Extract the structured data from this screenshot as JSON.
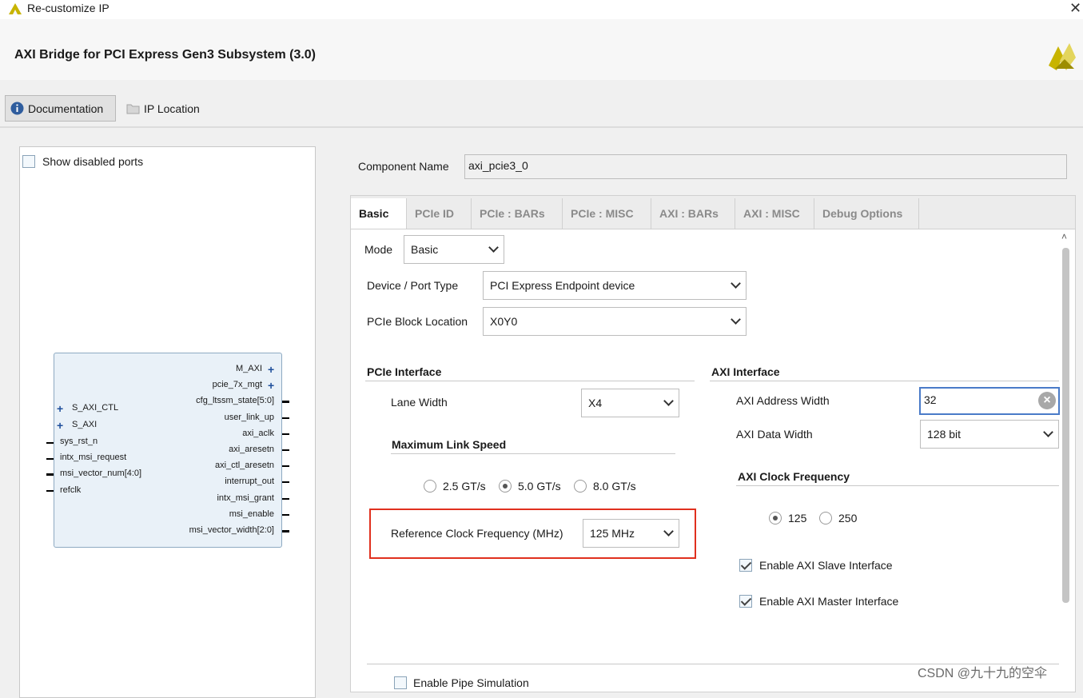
{
  "window": {
    "title": "Re-customize IP",
    "close_glyph": "✕"
  },
  "ip": {
    "title": "AXI Bridge for PCI Express Gen3 Subsystem (3.0)"
  },
  "toolbar": {
    "documentation": "Documentation",
    "ip_location": "IP Location"
  },
  "left": {
    "show_disabled_ports": "Show disabled ports",
    "block": {
      "left_ports": [
        "S_AXI_CTL",
        "S_AXI",
        "sys_rst_n",
        "intx_msi_request",
        "msi_vector_num[4:0]",
        "refclk"
      ],
      "right_ports": [
        "M_AXI",
        "pcie_7x_mgt",
        "cfg_ltssm_state[5:0]",
        "user_link_up",
        "axi_aclk",
        "axi_aresetn",
        "axi_ctl_aresetn",
        "interrupt_out",
        "intx_msi_grant",
        "msi_enable",
        "msi_vector_width[2:0]"
      ]
    }
  },
  "component": {
    "label": "Component Name",
    "value": "axi_pcie3_0"
  },
  "tabs": [
    "Basic",
    "PCIe ID",
    "PCIe : BARs",
    "PCIe : MISC",
    "AXI : BARs",
    "AXI : MISC",
    "Debug Options"
  ],
  "basic": {
    "mode_label": "Mode",
    "mode_value": "Basic",
    "device_label": "Device / Port Type",
    "device_value": "PCI Express Endpoint device",
    "location_label": "PCIe Block Location",
    "location_value": "X0Y0",
    "pcie_interface": {
      "title": "PCIe Interface",
      "lane_width_label": "Lane Width",
      "lane_width_value": "X4",
      "max_link_speed_title": "Maximum Link Speed",
      "speeds": [
        "2.5 GT/s",
        "5.0 GT/s",
        "8.0 GT/s"
      ],
      "selected_speed": "5.0 GT/s",
      "ref_clock_label": "Reference Clock Frequency (MHz)",
      "ref_clock_value": "125 MHz"
    },
    "axi_interface": {
      "title": "AXI Interface",
      "addr_width_label": "AXI Address Width",
      "addr_width_value": "32",
      "data_width_label": "AXI Data Width",
      "data_width_value": "128 bit",
      "clock_title": "AXI Clock Frequency",
      "clocks": [
        "125",
        "250"
      ],
      "selected_clock": "125",
      "enable_slave": "Enable AXI Slave Interface",
      "enable_master": "Enable AXI Master Interface"
    },
    "pipe_sim": "Enable Pipe Simulation"
  },
  "watermark": "CSDN @九十九的空伞",
  "colors": {
    "highlight": "#e0301e",
    "focus": "#4a7bc8",
    "brand_yellow": "#c8b400"
  }
}
